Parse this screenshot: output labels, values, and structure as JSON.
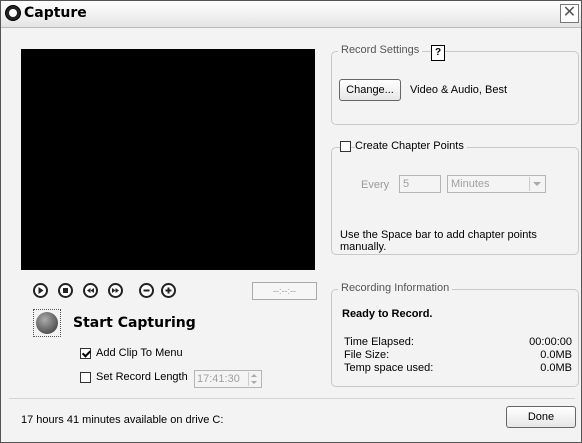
{
  "window": {
    "title": "Capture",
    "close": "✕"
  },
  "transport": {
    "buttons": [
      "play-icon",
      "stop-icon",
      "rewind-icon",
      "fast-forward-icon",
      "zoom-out-icon",
      "zoom-in-icon"
    ],
    "timecode": "--:--:--"
  },
  "record": {
    "label": "Start Capturing"
  },
  "options": {
    "add_clip": {
      "label": "Add Clip To Menu",
      "checked": true
    },
    "set_length": {
      "label": "Set Record Length",
      "checked": false,
      "value": "17:41:30"
    }
  },
  "record_settings": {
    "legend": "Record Settings",
    "help": "?",
    "change_button": "Change...",
    "summary": "Video & Audio, Best"
  },
  "chapters": {
    "label": "Create Chapter Points",
    "checked": false,
    "every_label": "Every",
    "every_value": "5",
    "unit": "Minutes",
    "hint": "Use the Space bar to add chapter points manually."
  },
  "recording_info": {
    "legend": "Recording Information",
    "status": "Ready to Record.",
    "rows": [
      {
        "label": "Time Elapsed:",
        "value": "00:00:00"
      },
      {
        "label": "File Size:",
        "value": "0.0MB"
      },
      {
        "label": "Temp space used:",
        "value": "0.0MB"
      }
    ]
  },
  "footer": {
    "status": "17 hours 41 minutes available on drive C:",
    "done_button": "Done"
  }
}
